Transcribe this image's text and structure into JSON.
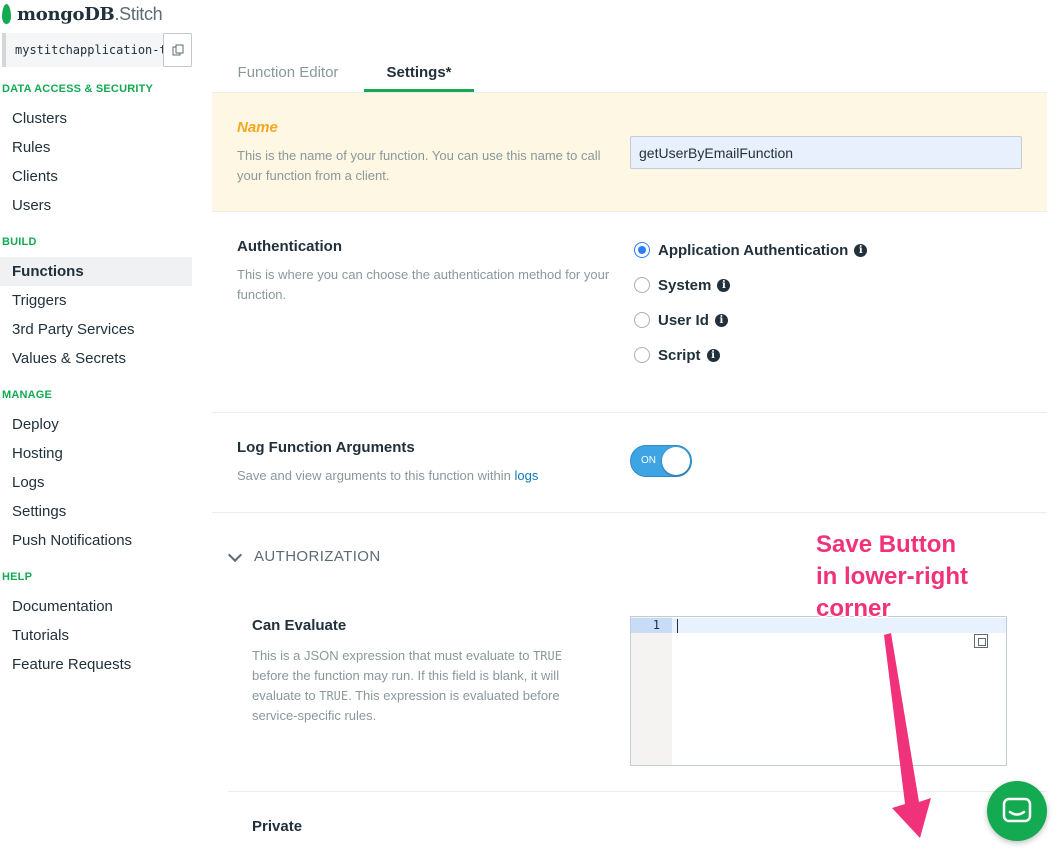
{
  "brand": {
    "name_bold": "mongoDB",
    "name_suffix": ".Stitch"
  },
  "app_id": "mystitchapplication-t",
  "sidebar": {
    "sections": [
      {
        "title": "DATA ACCESS & SECURITY",
        "items": [
          "Clusters",
          "Rules",
          "Clients",
          "Users"
        ]
      },
      {
        "title": "BUILD",
        "items": [
          "Functions",
          "Triggers",
          "3rd Party Services",
          "Values & Secrets"
        ]
      },
      {
        "title": "MANAGE",
        "items": [
          "Deploy",
          "Hosting",
          "Logs",
          "Settings",
          "Push Notifications"
        ]
      },
      {
        "title": "HELP",
        "items": [
          "Documentation",
          "Tutorials",
          "Feature Requests"
        ]
      }
    ],
    "active_item": "Functions"
  },
  "tabs": [
    {
      "label": "Function Editor",
      "active": false
    },
    {
      "label": "Settings*",
      "active": true
    }
  ],
  "name_section": {
    "label": "Name",
    "description": "This is the name of your function. You can use this name to call your function from a client.",
    "value": "getUserByEmailFunction"
  },
  "auth_section": {
    "label": "Authentication",
    "description": "This is where you can choose the authentication method for your function.",
    "options": [
      {
        "label": "Application Authentication",
        "selected": true
      },
      {
        "label": "System",
        "selected": false
      },
      {
        "label": "User Id",
        "selected": false
      },
      {
        "label": "Script",
        "selected": false
      }
    ]
  },
  "log_section": {
    "label": "Log Function Arguments",
    "description_prefix": "Save and view arguments to this function within ",
    "description_link": "logs",
    "toggle_label": "ON",
    "toggle_on": true
  },
  "authorization": {
    "title": "AUTHORIZATION",
    "can_evaluate_label": "Can Evaluate",
    "can_evaluate_desc_1": "This is a JSON expression that must evaluate to ",
    "can_evaluate_code_1": "TRUE",
    "can_evaluate_desc_2": " before the function may run. If this field is blank, it will evaluate to ",
    "can_evaluate_code_2": "TRUE",
    "can_evaluate_desc_3": ". This expression is evaluated before service-specific rules.",
    "editor_line_number": "1",
    "private_label": "Private"
  },
  "annotation": {
    "line1": "Save Button",
    "line2": "in lower-right",
    "line3": "corner"
  },
  "colors": {
    "brand_green": "#13aa52",
    "annotation_pink": "#f0327a",
    "toggle_blue": "#3fa4e4",
    "name_label": "#f5a623"
  }
}
